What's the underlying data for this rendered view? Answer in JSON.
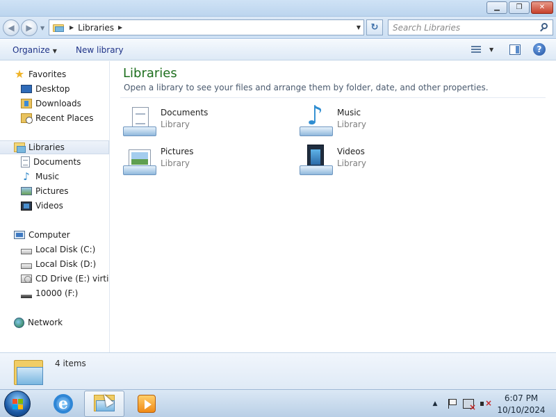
{
  "titlebar": {
    "minimize_glyph": "▁",
    "maximize_glyph": "❐",
    "close_glyph": "✕"
  },
  "nav": {
    "back_glyph": "◀",
    "forward_glyph": "▶",
    "recent_glyph": "▼",
    "breadcrumb": [
      "Libraries"
    ],
    "crumb_sep": "▶",
    "dropdown_glyph": "▼",
    "refresh_glyph": "↻",
    "search_placeholder": "Search Libraries"
  },
  "commandbar": {
    "organize_label": "Organize",
    "organize_caret": "▼",
    "new_library_label": "New library",
    "views_caret": "▼",
    "help_glyph": "?"
  },
  "navpane": {
    "favorites": {
      "label": "Favorites",
      "star_glyph": "★",
      "items": [
        {
          "label": "Desktop"
        },
        {
          "label": "Downloads"
        },
        {
          "label": "Recent Places"
        }
      ]
    },
    "libraries": {
      "label": "Libraries",
      "items": [
        {
          "label": "Documents"
        },
        {
          "label": "Music",
          "glyph": "♪"
        },
        {
          "label": "Pictures"
        },
        {
          "label": "Videos"
        }
      ]
    },
    "computer": {
      "label": "Computer",
      "items": [
        {
          "label": "Local Disk (C:)"
        },
        {
          "label": "Local Disk (D:)"
        },
        {
          "label": "CD Drive (E:) virtio-w"
        },
        {
          "label": "10000 (F:)"
        }
      ]
    },
    "network": {
      "label": "Network"
    }
  },
  "main": {
    "title": "Libraries",
    "subtitle": "Open a library to see your files and arrange them by folder, date, and other properties.",
    "items": [
      {
        "name": "Documents",
        "type": "Library"
      },
      {
        "name": "Music",
        "type": "Library",
        "glyph": "♪"
      },
      {
        "name": "Pictures",
        "type": "Library"
      },
      {
        "name": "Videos",
        "type": "Library"
      }
    ]
  },
  "details": {
    "count_text": "4 items"
  },
  "taskbar": {
    "tray_up_glyph": "▲",
    "time": "6:07 PM",
    "date": "10/10/2024"
  },
  "colors": {
    "title_green": "#1e6f1e",
    "command_text": "#1e3287",
    "accent_blue": "#2f87c9"
  }
}
